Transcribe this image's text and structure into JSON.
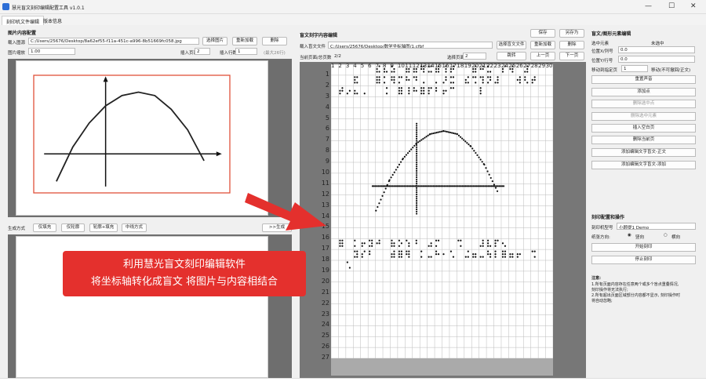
{
  "window": {
    "title": "慧光盲文刻印编辑配置工具 v1.0.1",
    "min_glyph": "—",
    "max_glyph": "☐",
    "close_glyph": "✕"
  },
  "tabs": [
    "刻印机文件编辑",
    "版本信息"
  ],
  "left": {
    "section_title": "图片内容配置",
    "import_label": "载入图源",
    "image_path": "C:/Users/25676/Desktop/8a62ef55-f11a-451c-a996-8b51669fc058.jpg",
    "choose_image": "选择图片",
    "reload": "重新加载",
    "delete": "删除",
    "zoom_label": "图片缩放",
    "zoom_value": "1.00",
    "insert_page_label": "插入页面",
    "insert_page_value": "2",
    "insert_row_label": "插入行数",
    "insert_row_value": "1",
    "row_hint": "(最大26行)",
    "gen_label": "生成方式",
    "gen_buttons": [
      "仅填充",
      "仅轮廓",
      "轮廓+填充",
      "中线方式"
    ],
    "next_hint": ">>生成"
  },
  "middle": {
    "section_title": "盲文刻字内容编辑",
    "save": "保存",
    "save_as": "另存为",
    "import_label": "载入盲文文件",
    "file_path": "C:/Users/25676/Desktop/数学坐标轴图/1.cfbf",
    "choose_file": "选择盲文文件",
    "reload": "重新加载",
    "delete": "删除",
    "page_info_label": "当前页面/总页数",
    "page_info_value": "2/2",
    "select_page_label": "选择页面",
    "select_page_value": "2",
    "jump": "跳转",
    "prev": "上一页",
    "next": "下一页",
    "col_numbers": [
      "1",
      "2",
      "3",
      "4",
      "5",
      "6",
      "7",
      "8",
      "9",
      "10",
      "11",
      "12",
      "13",
      "14",
      "15",
      "16",
      "17",
      "18",
      "19",
      "20",
      "21",
      "22",
      "23",
      "24",
      "25",
      "26",
      "27",
      "28",
      "29",
      "30"
    ],
    "row_numbers": [
      "1",
      "2",
      "3",
      "4",
      "5",
      "6",
      "7",
      "8",
      "9",
      "10",
      "11",
      "12",
      "13",
      "14",
      "15",
      "16",
      "17",
      "18",
      "19",
      "20",
      "21",
      "22",
      "23",
      "24",
      "25",
      "26",
      "27"
    ]
  },
  "right": {
    "section_title": "盲文/图形元素编辑",
    "selected_label": "选中元素",
    "selected_value": "未选中",
    "xpos_label": "位置X/列号",
    "xpos_value": "0.0",
    "ypos_label": "位置Y/行号",
    "ypos_value": "0.0",
    "move_label": "移动到指定页",
    "move_value": "1",
    "move_hint": "移动(不可撤回/正文)",
    "buttons": [
      "重置声音",
      "添加点",
      "删除选中点",
      "删除选中元素",
      "插入空白页",
      "删除当前页",
      "添加编辑文字盲文-正文",
      "添加编辑文字盲文-添加"
    ],
    "print_title": "刻印配置和操作",
    "printer_label": "刻印机型号",
    "printer_value": "小顾提1 Demo",
    "orient_label": "纸张方向:",
    "orient_portrait": "竖向",
    "orient_landscape": "横向",
    "start_print": "开始刻印",
    "stop_print": "停止刻印",
    "notes_title": "注意:",
    "notes": [
      "1.所有页面内容存在任意两个或多个盲点重叠情况,",
      "  刻印操作将无法执行;",
      "2.所有超出页面区域部分内容都不显示, 刻印操作时",
      "  将自动忽略;"
    ]
  },
  "banner": {
    "line1": "利用慧光盲文刻印编辑软件",
    "line2": "将坐标轴转化成盲文 将图片与内容相结合"
  },
  "chart_data": {
    "type": "line",
    "title": "",
    "xlabel": "",
    "ylabel": "",
    "series": [
      {
        "x": [
          -1.2,
          -0.8,
          -0.4,
          0,
          0.4,
          0.8,
          1.2,
          1.6,
          2.0,
          2.4
        ],
        "values": [
          -0.8,
          0.2,
          0.9,
          1.4,
          1.7,
          1.8,
          1.7,
          1.3,
          0.7,
          -0.2
        ]
      }
    ]
  }
}
